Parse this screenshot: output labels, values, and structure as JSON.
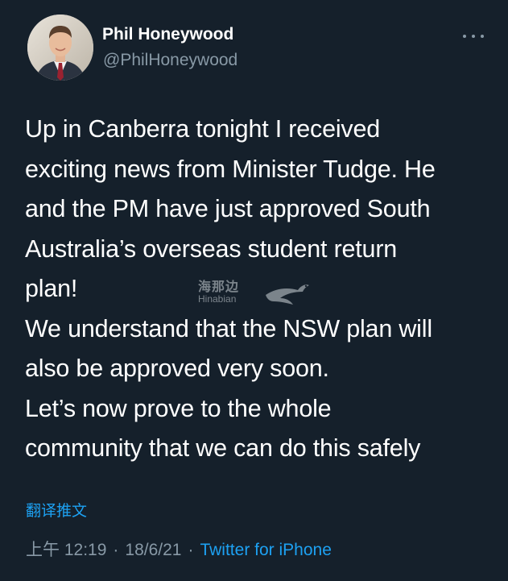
{
  "author": {
    "display_name": "Phil Honeywood",
    "handle": "@PhilHoneywood",
    "avatar_icon": "profile-photo"
  },
  "tweet": {
    "lines": [
      "Up in Canberra tonight I received",
      "exciting news from Minister Tudge. He",
      "and the PM have just approved South",
      "Australia’s overseas student return",
      "plan!",
      "We understand that the NSW plan will",
      "also be approved very soon.",
      "Let’s now prove to the whole",
      "community that we can do this safely"
    ]
  },
  "watermark": {
    "chinese": "海那边",
    "english": "Hinabian"
  },
  "translate_label": "翻译推文",
  "meta": {
    "time": "上午 12:19",
    "separator": "·",
    "date": "18/6/21",
    "source": "Twitter for iPhone"
  },
  "colors": {
    "background": "#15202b",
    "primary_text": "#ffffff",
    "secondary_text": "#8899a6",
    "accent": "#1da1f2"
  },
  "icons": {
    "more": "more-options-icon"
  }
}
